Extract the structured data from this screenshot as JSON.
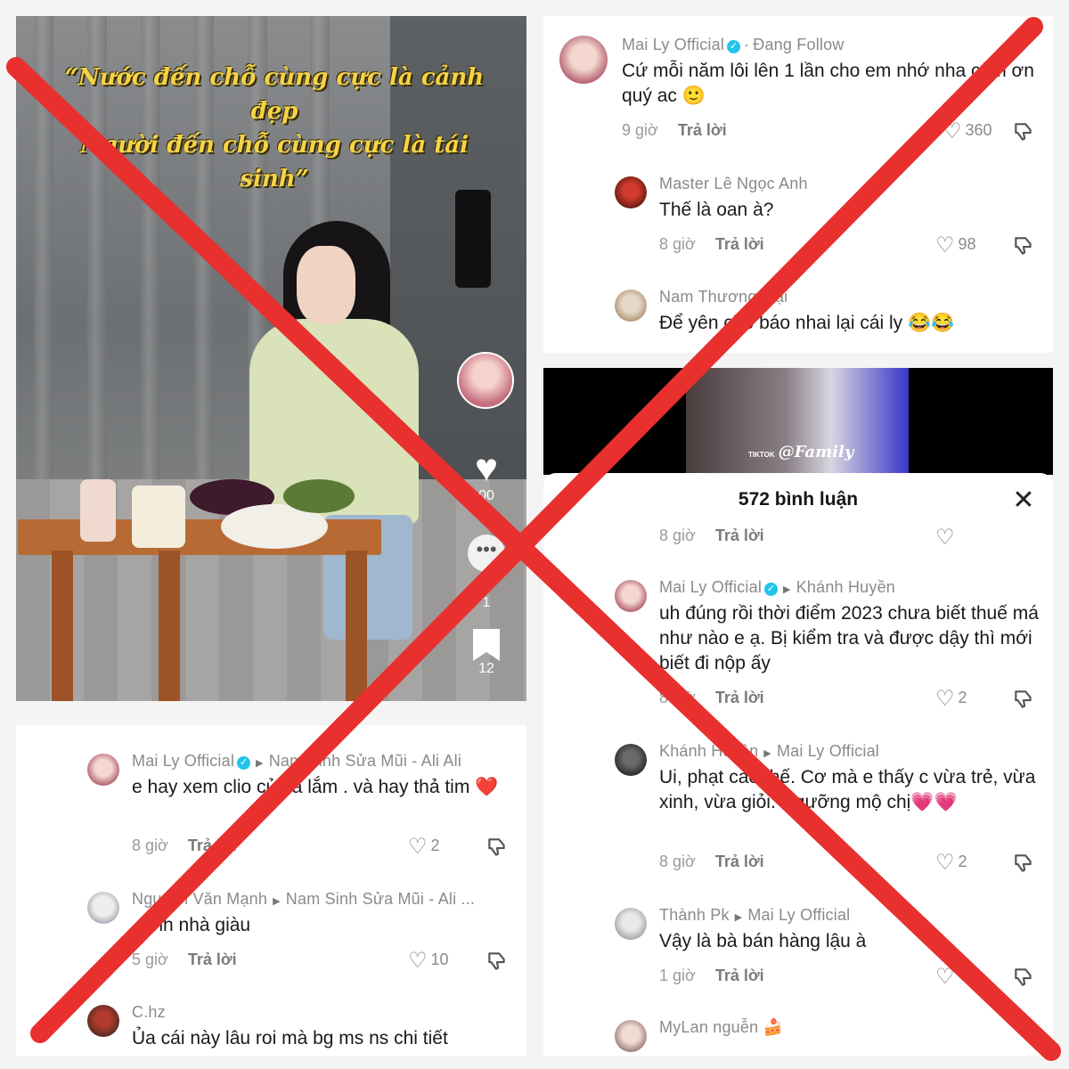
{
  "video": {
    "caption_line1": "“Nước đến chỗ cùng cực là cảnh đẹp",
    "caption_line2": "Người đến chỗ cùng cực là tái sinh”",
    "like_count": "00",
    "comment_count": "1",
    "bookmark_count": "12",
    "icons": [
      "heart-icon",
      "more-icon",
      "bookmark-icon"
    ]
  },
  "bottom_left_comments": [
    {
      "user": "Mai Ly Official",
      "verified": true,
      "reply_to": "Nam Sinh Sửa Mũi - Ali Ali",
      "text": "e hay xem clio của a lắm . và hay thả tim ❤️",
      "time": "8 giờ",
      "reply_label": "Trả lời",
      "likes": "2"
    },
    {
      "user": "Nguyen Văn Mạnh",
      "verified": false,
      "reply_to": "Nam Sinh Sửa Mũi - Ali ...",
      "text": "... nh nhà giàu",
      "time": "5 giờ",
      "reply_label": "Trả lời",
      "likes": "10"
    },
    {
      "user": "C.hz",
      "verified": false,
      "reply_to": "",
      "text": "Ủa cái này lâu roi mà bg ms ns chi tiết",
      "time": "",
      "reply_label": "",
      "likes": ""
    }
  ],
  "top_right_comments": [
    {
      "user": "Mai Ly Official",
      "verified": true,
      "reply_to": "Đang Follow",
      "text": "Cứ mỗi năm lôi lên 1 lần cho em nhớ nha cảm ơn quý ac 🙂",
      "time": "9 giờ",
      "reply_label": "Trả lời",
      "likes": "360"
    },
    {
      "user": "Master Lê Ngọc Anh",
      "verified": false,
      "reply_to": "",
      "text": "Thế là oan à?",
      "time": "8 giờ",
      "reply_label": "Trả lời",
      "likes": "98"
    },
    {
      "user": "Nam Thương Mại",
      "verified": false,
      "reply_to": "",
      "text": "Để yên cho báo nhai lại cái ly 😂😂",
      "time": "",
      "reply_label": "",
      "likes": ""
    }
  ],
  "video_strip": {
    "watermark_small": "TIKTOK",
    "watermark": "@Family"
  },
  "sheet": {
    "title": "572 bình luận",
    "partial_meta": {
      "time": "8 giờ",
      "reply_label": "Trả lời"
    },
    "comments": [
      {
        "user": "Mai Ly Official",
        "verified": true,
        "reply_to": "Khánh Huyền",
        "text": "uh đúng rồi thời điểm 2023 chưa biết thuế má như nào e ạ. Bị kiểm tra và được dậy thì mới biết đi nộp ấy",
        "time": "8 giờ",
        "reply_label": "Trả lời",
        "likes": "2"
      },
      {
        "user": "Khánh Huyền",
        "verified": false,
        "reply_to": "Mai Ly Official",
        "text": "Ui, phạt cao thế. Cơ mà e thấy c vừa trẻ, vừa xinh, vừa giỏi. Ngưỡng mộ chị💗💗",
        "time": "8 giờ",
        "reply_label": "Trả lời",
        "likes": "2"
      },
      {
        "user": "Thành Pk",
        "verified": false,
        "reply_to": "Mai Ly Official",
        "text": "Vậy là bà bán hàng lậu à",
        "time": "1 giờ",
        "reply_label": "Trả lời",
        "likes": ""
      },
      {
        "user": "MyLan nguễn 🍰",
        "verified": false,
        "reply_to": "",
        "text": "",
        "time": "",
        "reply_label": "",
        "likes": ""
      }
    ]
  },
  "overlay": {
    "mark": "red-x",
    "color": "#e8302f"
  },
  "colors": {
    "text_primary": "#1a1a1a",
    "text_meta": "#8a8a8a",
    "verified": "#20c4ea",
    "caption": "#f4d349"
  }
}
